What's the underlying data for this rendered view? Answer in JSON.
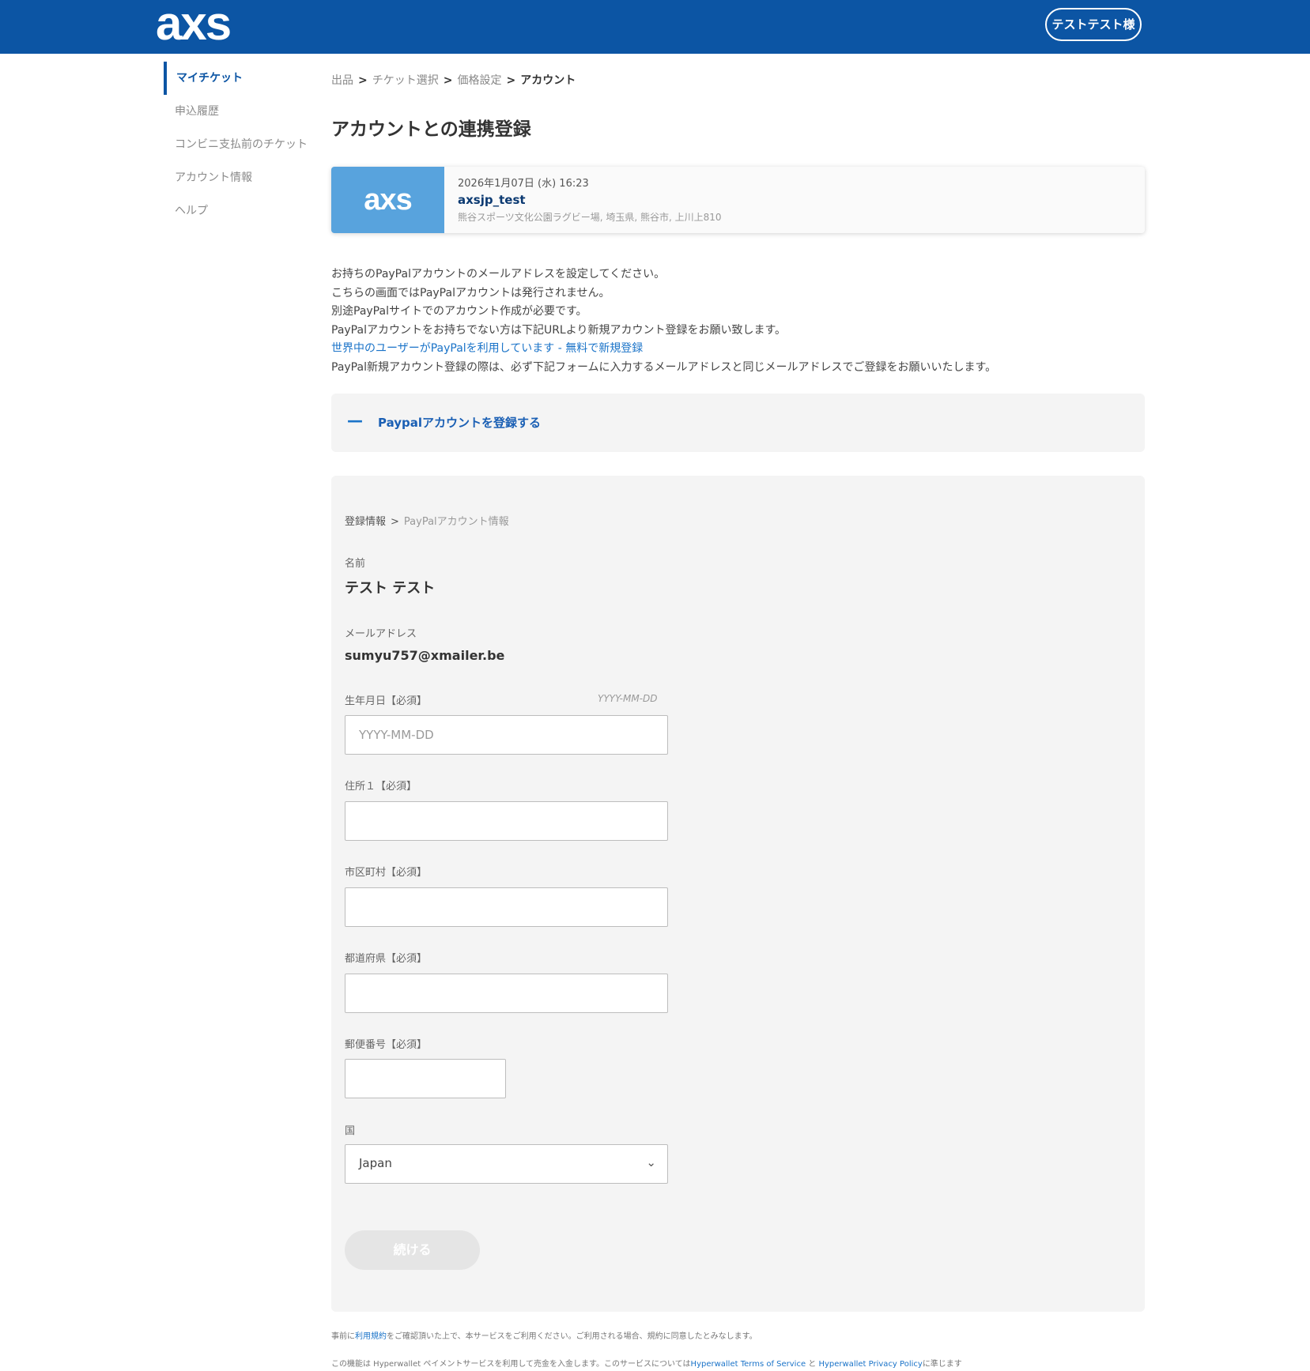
{
  "header": {
    "logo": "axs",
    "user": "テストテスト様"
  },
  "sidebar": {
    "items": [
      {
        "label": "マイチケット",
        "active": true
      },
      {
        "label": "申込履歴",
        "active": false
      },
      {
        "label": "コンビニ支払前のチケット",
        "active": false
      },
      {
        "label": "アカウント情報",
        "active": false
      },
      {
        "label": "ヘルプ",
        "active": false
      }
    ]
  },
  "breadcrumb": {
    "items": [
      "出品",
      "チケット選択",
      "価格設定"
    ],
    "current": "アカウント",
    "sep": ">"
  },
  "page_title": "アカウントとの連携登録",
  "event": {
    "thumb": "axs",
    "date": "2026年1月07日 (水) 16:23",
    "name": "axsjp_test",
    "venue": "熊谷スポーツ文化公園ラグビー場, 埼玉県, 熊谷市, 上川上810"
  },
  "intro": {
    "line1": "お持ちのPayPalアカウントのメールアドレスを設定してください。",
    "line2": "こちらの画面ではPayPalアカウントは発行されません。",
    "line3": "別途PayPalサイトでのアカウント作成が必要です。",
    "line4": "PayPalアカウントをお持ちでない方は下記URLより新規アカウント登録をお願い致します。",
    "link": "世界中のユーザーがPayPalを利用しています - 無料で新規登録",
    "line5": "PayPal新規アカウント登録の際は、必ず下記フォームに入力するメールアドレスと同じメールアドレスでご登録をお願いいたします。"
  },
  "accordion": {
    "icon": "minus-icon",
    "label": "Paypalアカウントを登録する"
  },
  "form": {
    "breadcrumb": {
      "first": "登録情報",
      "sep": ">",
      "current": "PayPalアカウント情報"
    },
    "name_label": "名前",
    "name_value": "テスト テスト",
    "email_label": "メールアドレス",
    "email_value": "sumyu757@xmailer.be",
    "dob_label": "生年月日【必須】",
    "dob_hint": "YYYY-MM-DD",
    "dob_placeholder": "YYYY-MM-DD",
    "address1_label": "住所１【必須】",
    "city_label": "市区町村【必須】",
    "prefecture_label": "都道府県【必須】",
    "postal_label": "郵便番号【必須】",
    "country_label": "国",
    "country_value": "Japan",
    "submit_label": "続ける"
  },
  "footer": {
    "line1_pre": "事前に",
    "line1_link": "利用規約",
    "line1_post": "をご確認頂いた上で、本サービスをご利用ください。ご利用される場合、規約に同意したとみなします。",
    "line2_pre": "この機能は Hyperwallet ペイメントサービスを利用して売金を入金します。このサービスについては",
    "line2_link1": "Hyperwallet Terms of Service",
    "line2_mid": " と ",
    "line2_link2": "Hyperwallet Privacy Policy",
    "line2_post": "に準じます"
  },
  "colors": {
    "brand": "#0c55a4",
    "thumb": "#58a3dd",
    "link": "#1a73c8",
    "panel": "#f4f4f4"
  }
}
